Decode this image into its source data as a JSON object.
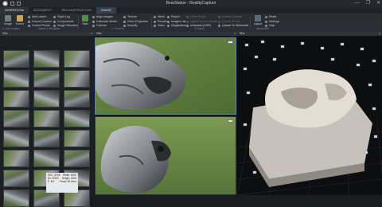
{
  "window": {
    "title": "BearStatue - RealityCapture",
    "controls": [
      "—",
      "❐",
      "✕"
    ]
  },
  "tabs": [
    {
      "label": "WORKFLOW",
      "active": true
    },
    {
      "label": "ALIGNMENT",
      "active": false
    },
    {
      "label": "RECONSTRUCTION",
      "active": false
    },
    {
      "label": "IMAGE",
      "active": false
    }
  ],
  "ribbon": {
    "image_button": "Image",
    "folder_button": "Folder",
    "import_items": [
      "Flight Log",
      "Ground Control",
      "Control Points"
    ],
    "import_items2": [
      "Add Lasers",
      "Components",
      "Image Selection"
    ],
    "start_button": "Start",
    "process_items": [
      "Align Images",
      "Calculate Model",
      "Colorize"
    ],
    "process_items2": [
      "Texture",
      "Ortho Projection",
      "Simplify"
    ],
    "export_items": [
      "Mesh",
      "Render",
      "Video"
    ],
    "export_items2": [
      "Report",
      "Images List",
      "Registration"
    ],
    "export_items3": [
      "Ortho Photo",
      "Digital Surface Model",
      "Metadata (XMP)"
    ],
    "export_items4": [
      "Ground Control",
      "Control Points",
      "Upload To Sketchfab"
    ],
    "layout_button": "Layout",
    "app_items": [
      "Reset",
      "Settings",
      "Help"
    ],
    "group_labels": [
      "1. Add imagery",
      "Import & Metadata",
      "2. Process",
      "3. Export",
      "Application"
    ]
  },
  "panels": {
    "images_title": "1Ds",
    "view_title": "2Ds",
    "model_title": "3Ds"
  },
  "tooltip": {
    "lines": [
      [
        "DSC_8755",
        "Width: 6000"
      ],
      [
        "Ex: 1/400",
        "Height: 4000"
      ],
      [
        "F: 8.0",
        "Focal: 35.0mm"
      ]
    ]
  },
  "colors": {
    "accent": "#3c8fd8",
    "panel_bg": "#1d2023",
    "ribbon_bg": "#2a2e33"
  }
}
